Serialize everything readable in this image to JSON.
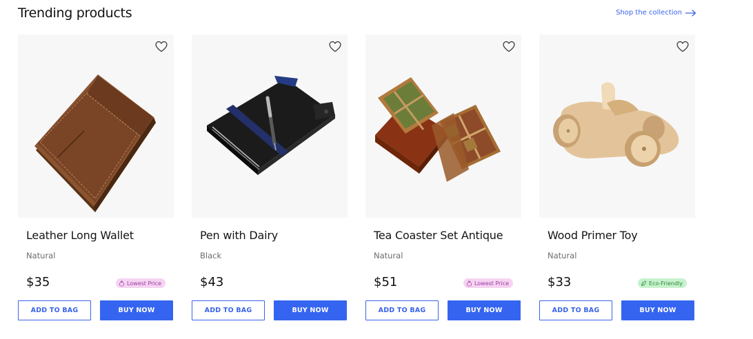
{
  "header": {
    "title": "Trending products",
    "shop_link_label": "Shop the collection",
    "shop_link_icon": "arrow-right-icon"
  },
  "colors": {
    "accent": "#3565f0",
    "lowest_price_badge_bg": "#f6d3f2",
    "eco_badge_bg": "#c8f1cd",
    "image_bg": "#f7f7f7"
  },
  "products": [
    {
      "name": "Leather Long Wallet",
      "variant": "Natural",
      "price": "$35",
      "badge": {
        "label": "Lowest Price",
        "type": "lowest",
        "icon": "money-bag-icon"
      },
      "image": "leather-wallet",
      "add_label": "ADD TO BAG",
      "buy_label": "BUY NOW"
    },
    {
      "name": "Pen with Dairy",
      "variant": "Black",
      "price": "$43",
      "badge": null,
      "image": "pen-diary",
      "add_label": "ADD TO BAG",
      "buy_label": "BUY NOW"
    },
    {
      "name": "Tea Coaster Set Antique",
      "variant": "Natural",
      "price": "$51",
      "badge": {
        "label": "Lowest Price",
        "type": "lowest",
        "icon": "money-bag-icon"
      },
      "image": "tea-coaster-set",
      "add_label": "ADD TO BAG",
      "buy_label": "BUY NOW"
    },
    {
      "name": "Wood Primer Toy",
      "variant": "Natural",
      "price": "$33",
      "badge": {
        "label": "Eco-Friendly",
        "type": "eco",
        "icon": "leaf-icon"
      },
      "image": "wooden-toy-car",
      "add_label": "ADD TO BAG",
      "buy_label": "BUY NOW"
    }
  ]
}
